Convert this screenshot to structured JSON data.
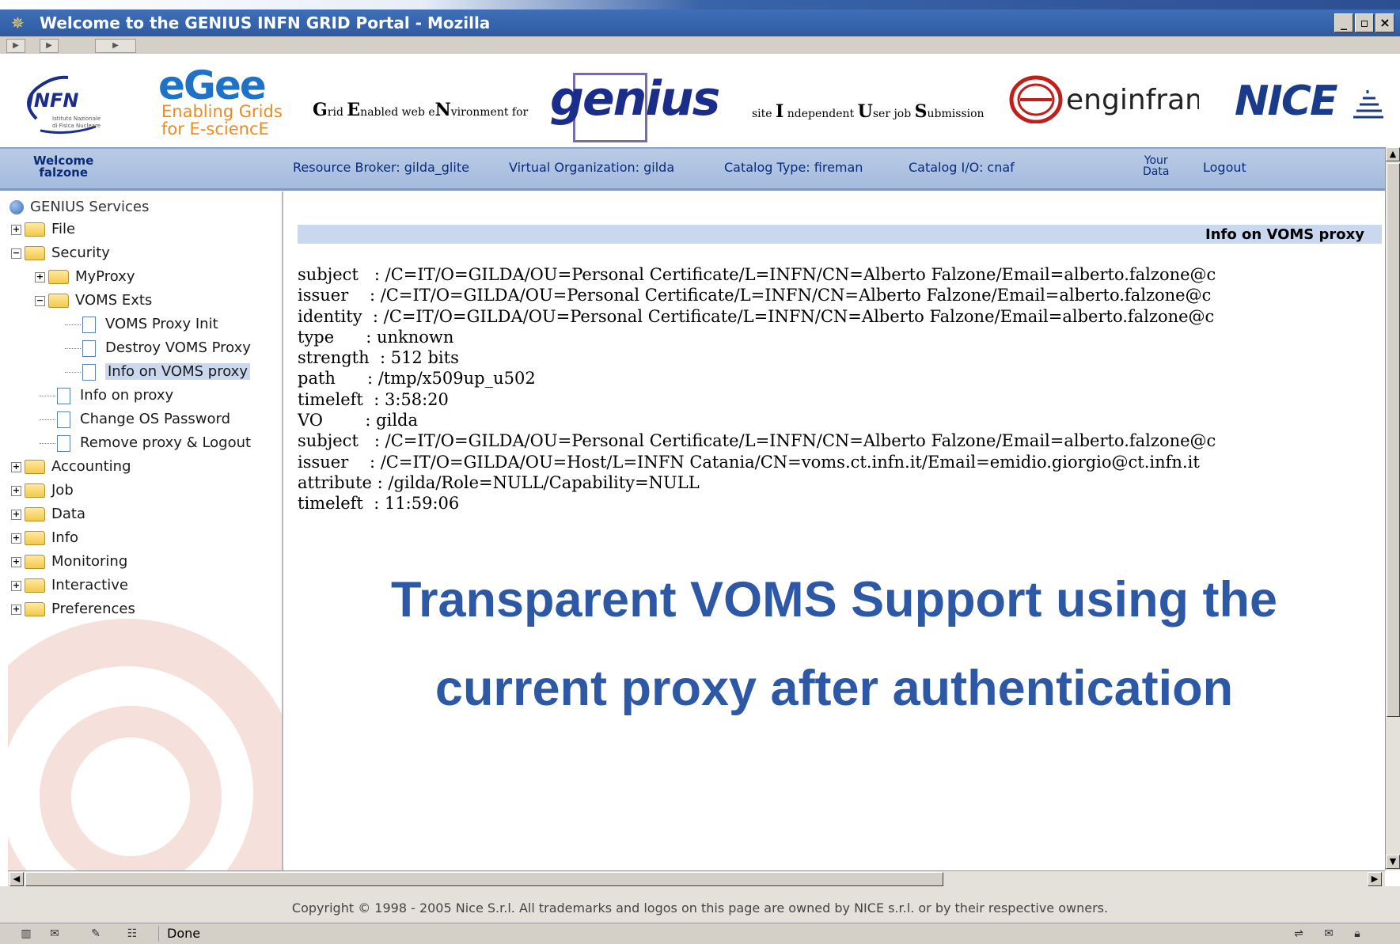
{
  "window": {
    "title": "Welcome to the GENIUS INFN GRID Portal - Mozilla",
    "buttons": {
      "minimize": "_",
      "maximize": "▫",
      "close": "×"
    }
  },
  "logos": {
    "egee_title": "eGee",
    "egee_line1": "Enabling Grids",
    "egee_line2": "for E-sciencE",
    "genius_tagline_prefix": "G",
    "genius_tagline_1": "rid ",
    "genius_tagline_E": "E",
    "genius_tagline_2": "nabled web e",
    "genius_tagline_N": "N",
    "genius_tagline_3": "vironment for",
    "genius": "genius",
    "site_I": "I",
    "site_1": " ndependent ",
    "site_U": "U",
    "site_2": "ser job ",
    "site_S": "S",
    "site_3": "ubmission",
    "site_prefix": "site ",
    "enginframe": "enginframe",
    "nice": "NICE"
  },
  "infobar": {
    "welcome_1": "Welcome",
    "welcome_2": "falzone",
    "resource_broker": "Resource Broker: gilda_glite",
    "vo": "Virtual Organization: gilda",
    "catalog_type": "Catalog Type: fireman",
    "catalog_io": "Catalog I/O: cnaf",
    "your_data_1": "Your",
    "your_data_2": "Data",
    "logout": "Logout"
  },
  "tree": {
    "root": "GENIUS Services",
    "items": [
      {
        "label": "File",
        "toggle": "+"
      },
      {
        "label": "Security",
        "toggle": "−"
      },
      {
        "label": "MyProxy",
        "toggle": "+"
      },
      {
        "label": "VOMS Exts",
        "toggle": "−"
      },
      {
        "label": "VOMS Proxy Init"
      },
      {
        "label": "Destroy VOMS Proxy"
      },
      {
        "label": "Info on VOMS proxy"
      },
      {
        "label": "Info on proxy"
      },
      {
        "label": "Change OS Password"
      },
      {
        "label": "Remove proxy & Logout"
      },
      {
        "label": "Accounting",
        "toggle": "+"
      },
      {
        "label": "Job",
        "toggle": "+"
      },
      {
        "label": "Data",
        "toggle": "+"
      },
      {
        "label": "Info",
        "toggle": "+"
      },
      {
        "label": "Monitoring",
        "toggle": "+"
      },
      {
        "label": "Interactive",
        "toggle": "+"
      },
      {
        "label": "Preferences",
        "toggle": "+"
      }
    ]
  },
  "main": {
    "banner": "Info on VOMS proxy",
    "proxy_lines": [
      "subject   : /C=IT/O=GILDA/OU=Personal Certificate/L=INFN/CN=Alberto Falzone/Email=alberto.falzone@c",
      "issuer    : /C=IT/O=GILDA/OU=Personal Certificate/L=INFN/CN=Alberto Falzone/Email=alberto.falzone@c",
      "identity  : /C=IT/O=GILDA/OU=Personal Certificate/L=INFN/CN=Alberto Falzone/Email=alberto.falzone@c",
      "type      : unknown",
      "strength  : 512 bits",
      "path      : /tmp/x509up_u502",
      "timeleft  : 3:58:20",
      "VO        : gilda",
      "subject   : /C=IT/O=GILDA/OU=Personal Certificate/L=INFN/CN=Alberto Falzone/Email=alberto.falzone@c",
      "issuer    : /C=IT/O=GILDA/OU=Host/L=INFN Catania/CN=voms.ct.infn.it/Email=emidio.giorgio@ct.infn.it",
      "attribute : /gilda/Role=NULL/Capability=NULL",
      "timeleft  : 11:59:06"
    ],
    "caption_line1": "Transparent VOMS Support using the",
    "caption_line2": "current proxy after authentication"
  },
  "footer": {
    "copyright": "Copyright © 1998 - 2005 Nice S.r.l. All trademarks and logos on this page are owned by NICE s.r.l. or by their respective owners."
  },
  "statusbar": {
    "status": "Done"
  },
  "colors": {
    "titlebar": "#2f5aa0",
    "infobar": "#b9cbe6",
    "caption": "#2d58a5",
    "banner": "#c9d7ef"
  }
}
